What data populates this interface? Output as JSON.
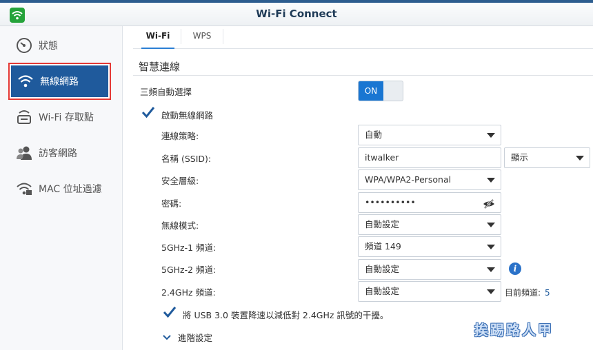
{
  "window": {
    "title": "Wi-Fi Connect"
  },
  "sidebar": {
    "items": [
      {
        "label": "狀態",
        "icon": "gauge-icon"
      },
      {
        "label": "無線網路",
        "icon": "wifi-icon",
        "active": true
      },
      {
        "label": "Wi-Fi 存取點",
        "icon": "router-icon"
      },
      {
        "label": "訪客網路",
        "icon": "users-icon"
      },
      {
        "label": "MAC 位址過濾",
        "icon": "wifi-filter-icon"
      }
    ]
  },
  "tabs": [
    {
      "label": "Wi-Fi",
      "active": true
    },
    {
      "label": "WPS",
      "active": false
    }
  ],
  "section": {
    "title": "智慧連線"
  },
  "tri_band": {
    "label": "三頻自動選擇",
    "toggle_label": "ON",
    "on": true
  },
  "enable_wireless": {
    "label": "啟動無線網路",
    "checked": true
  },
  "fields": {
    "strategy": {
      "label": "連線策略:",
      "value": "自動"
    },
    "ssid": {
      "label": "名稱 (SSID):",
      "value": "itwalker",
      "visibility": "顯示"
    },
    "security": {
      "label": "安全層級:",
      "value": "WPA/WPA2-Personal"
    },
    "password": {
      "label": "密碼:",
      "value": "••••••••••"
    },
    "mode": {
      "label": "無線模式:",
      "value": "自動設定"
    },
    "ch_5g1": {
      "label": "5GHz-1 頻道:",
      "value": "頻道 149"
    },
    "ch_5g2": {
      "label": "5GHz-2 頻道:",
      "value": "自動設定"
    },
    "ch_24g": {
      "label": "2.4GHz 頻道:",
      "value": "自動設定",
      "current_label": "目前頻道:",
      "current_value": "5"
    }
  },
  "usb_slowdown": {
    "label": "將 USB 3.0 裝置降速以減低對 2.4GHz 訊號的干擾。",
    "checked": true
  },
  "advanced": {
    "label": "進階設定"
  },
  "watermark": "挨踢路人甲",
  "colors": {
    "accent": "#1976d2",
    "sidebar_active": "#1f5a9c",
    "highlight_border": "#e53935"
  }
}
